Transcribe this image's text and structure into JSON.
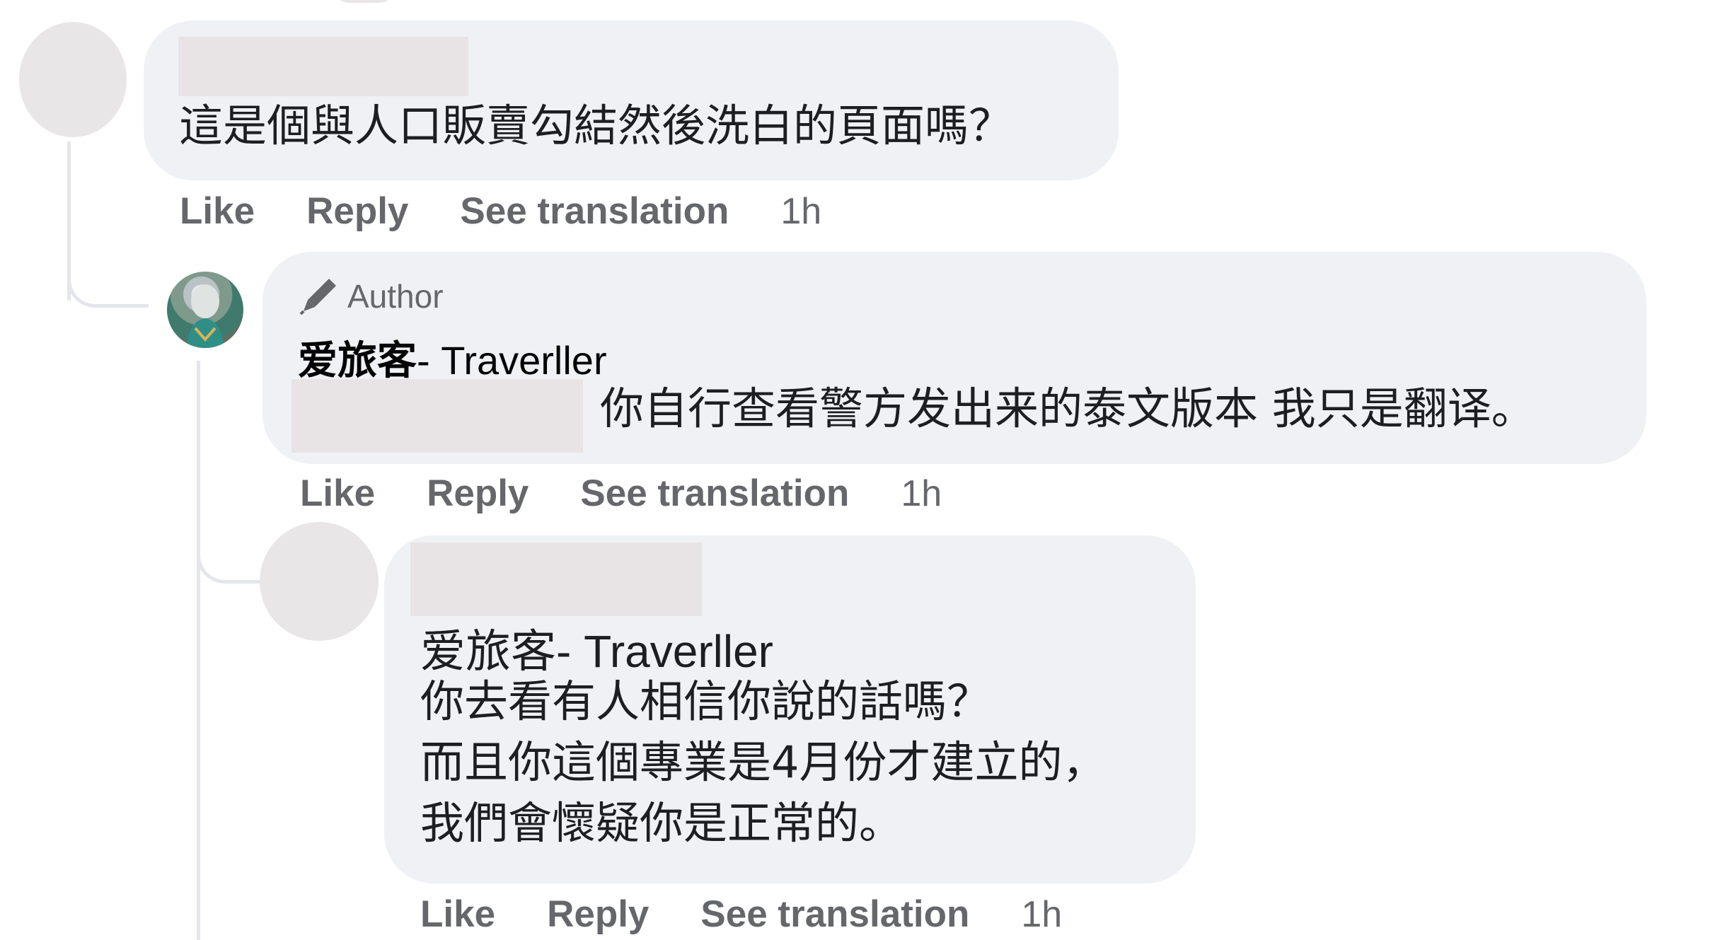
{
  "comments": [
    {
      "text": "這是個與人口販賣勾結然後洗白的頁面嗎？",
      "actions": {
        "like": "Like",
        "reply": "Reply",
        "translate": "See translation",
        "time": "1h"
      }
    },
    {
      "badge": "Author",
      "author_name_zh": "爱旅客",
      "author_name_en": "- Traverller",
      "text": "你自行查看警方发出来的泰文版本 我只是翻译。",
      "actions": {
        "like": "Like",
        "reply": "Reply",
        "translate": "See translation",
        "time": "1h"
      }
    },
    {
      "mention_zh": "爱旅客",
      "mention_en": "- Traverller",
      "lines": [
        "你去看有人相信你說的話嗎？",
        "而且你這個專業是4月份才建立的，",
        "我們會懷疑你是正常的。"
      ],
      "actions": {
        "like": "Like",
        "reply": "Reply",
        "translate": "See translation",
        "time": "1h"
      }
    }
  ],
  "colors": {
    "bubble": "#f0f1f5",
    "meta_text": "#65676b",
    "redaction": "#e8e4e5",
    "thread_line": "#e4e6eb"
  }
}
